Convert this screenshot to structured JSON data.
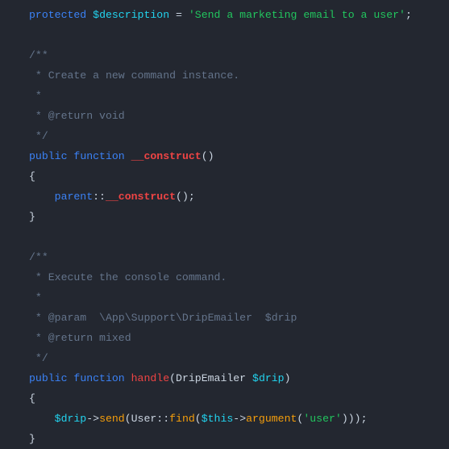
{
  "l1": {
    "protected": "protected",
    "var": "$description",
    "eq": " = ",
    "str": "'Send a marketing email to a user'",
    "semi": ";"
  },
  "c1": {
    "a": "/**",
    "b": " * Create a new command instance.",
    "c": " *",
    "d": " * @return void",
    "e": " */"
  },
  "ctor": {
    "pub": "public",
    "func": "function",
    "name": "__construct",
    "par": "()"
  },
  "br_open": "{",
  "pcall": {
    "parent": "parent",
    "dcol": "::",
    "name": "__construct",
    "par": "();"
  },
  "br_close": "}",
  "c2": {
    "a": "/**",
    "b": " * Execute the console command.",
    "c": " *",
    "d": " * @param  \\App\\Support\\DripEmailer  $drip",
    "e": " * @return mixed",
    "f": " */"
  },
  "handle": {
    "pub": "public",
    "func": "function",
    "name": "handle",
    "lp": "(",
    "type": "DripEmailer",
    "sp": " ",
    "var": "$drip",
    "rp": ")"
  },
  "body": {
    "drip": "$drip",
    "arrow1": "->",
    "send": "send",
    "lp1": "(",
    "user": "User",
    "dcol": "::",
    "find": "find",
    "lp2": "(",
    "this": "$this",
    "arrow2": "->",
    "argument": "argument",
    "lp3": "(",
    "str": "'user'",
    "close": ")));"
  }
}
